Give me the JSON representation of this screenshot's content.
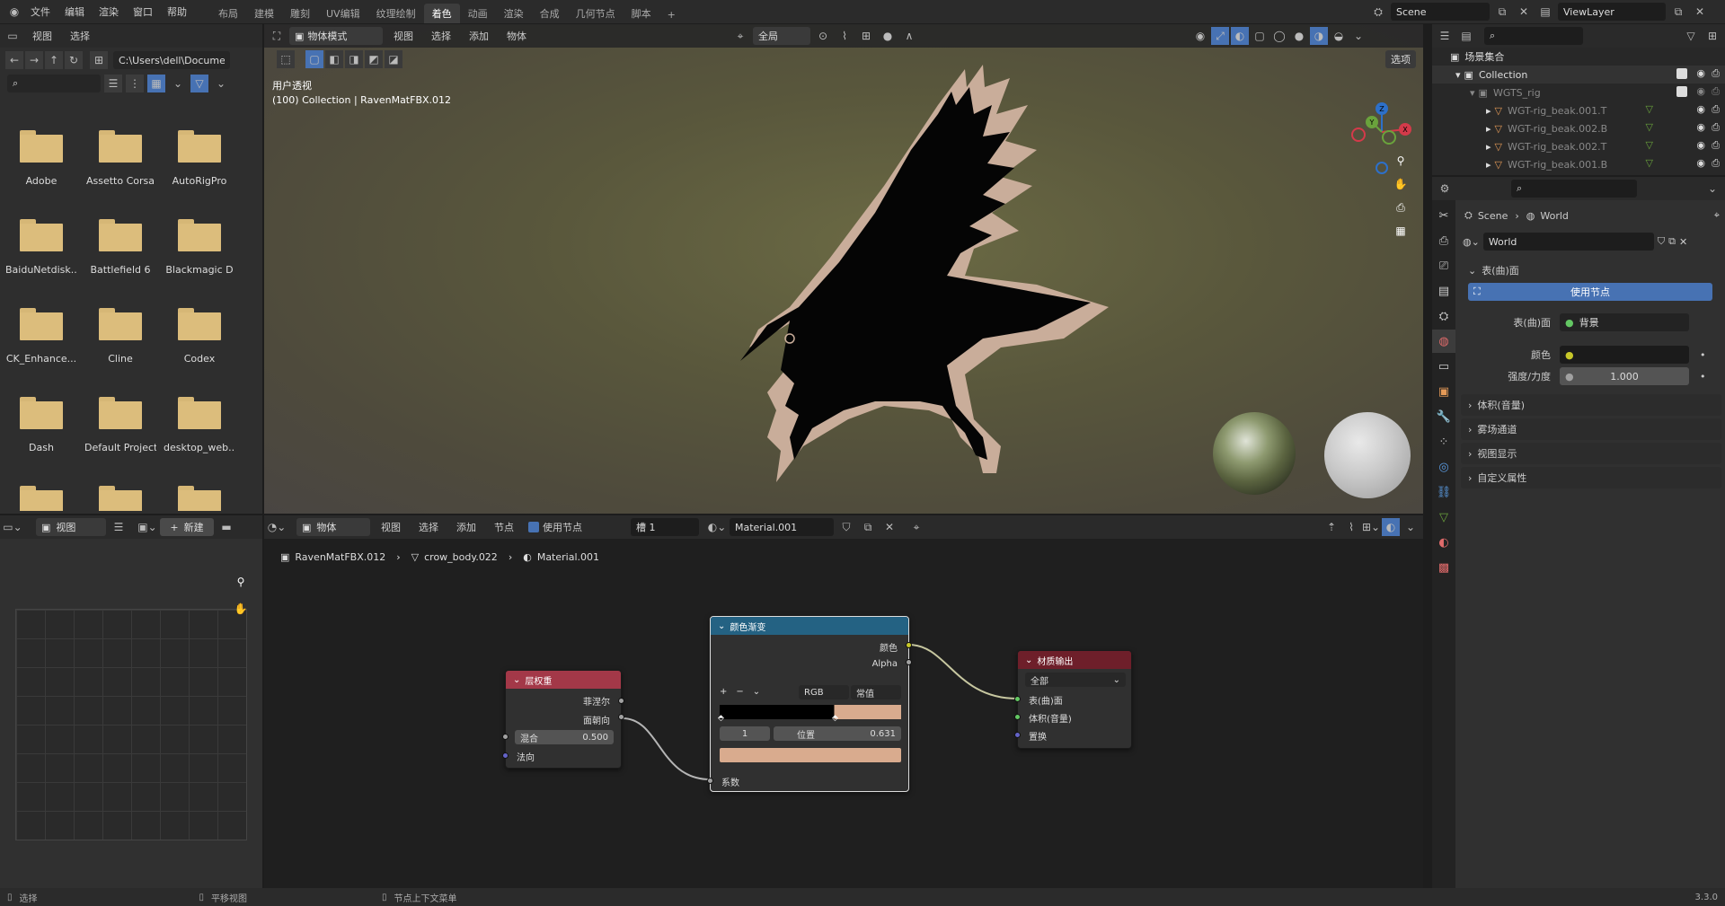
{
  "topbar": {
    "menus": [
      "文件",
      "编辑",
      "渲染",
      "窗口",
      "帮助"
    ],
    "workspaces": [
      "布局",
      "建模",
      "雕刻",
      "UV编辑",
      "纹理绘制",
      "着色",
      "动画",
      "渲染",
      "合成",
      "几何节点",
      "脚本"
    ],
    "active_workspace": "着色",
    "scene": "Scene",
    "view_layer": "ViewLayer"
  },
  "file_browser": {
    "menus": [
      "视图",
      "选择"
    ],
    "path": "C:\\Users\\dell\\Docume...",
    "folders": [
      "Adobe",
      "Assetto Corsa",
      "AutoRigPro",
      "BaiduNetdisk...",
      "Battlefield 6",
      "Blackmagic D",
      "CK_Enhance...",
      "Cline",
      "Codex",
      "Dash",
      "Default Project",
      "desktop_web..."
    ]
  },
  "viewport": {
    "mode": "物体模式",
    "menus": [
      "视图",
      "选择",
      "添加",
      "物体"
    ],
    "transform": "全局",
    "options": "选项",
    "view_name": "用户透视",
    "object_info": "(100) Collection | RavenMatFBX.012",
    "gizmo": {
      "x": "X",
      "y": "Y",
      "z": "Z"
    }
  },
  "outliner": {
    "root": "场景集合",
    "items": [
      {
        "label": "Collection",
        "level": 1
      },
      {
        "label": "WGTS_rig",
        "level": 2
      },
      {
        "label": "WGT-rig_beak.001.T",
        "level": 3
      },
      {
        "label": "WGT-rig_beak.002.B",
        "level": 3
      },
      {
        "label": "WGT-rig_beak.002.T",
        "level": 3
      },
      {
        "label": "WGT-rig_beak.001.B",
        "level": 3
      }
    ]
  },
  "properties": {
    "breadcrumb": [
      "Scene",
      "World"
    ],
    "world_name": "World",
    "surface_section": "表(曲)面",
    "use_nodes_button": "使用节点",
    "surface_label": "表(曲)面",
    "surface_value": "背景",
    "color_label": "颜色",
    "strength_label": "强度/力度",
    "strength_value": "1.000",
    "collapsed_sections": [
      "体积(音量)",
      "雾场通道",
      "视图显示",
      "自定义属性"
    ]
  },
  "image_editor": {
    "view_menu": "视图",
    "new_button": "新建"
  },
  "node_editor": {
    "type": "物体",
    "menus": [
      "视图",
      "选择",
      "添加",
      "节点"
    ],
    "use_nodes_label": "使用节点",
    "slot": "槽 1",
    "material": "Material.001",
    "breadcrumb": [
      "RavenMatFBX.012",
      "crow_body.022",
      "Material.001"
    ],
    "nodes": {
      "layer_weight": {
        "title": "层权重",
        "out_fresnel": "菲涅尔",
        "out_facing": "面朝向",
        "blend_label": "混合",
        "blend_value": "0.500",
        "in_normal": "法向"
      },
      "color_ramp": {
        "title": "颜色渐变",
        "out_color": "颜色",
        "out_alpha": "Alpha",
        "mode": "RGB",
        "interp": "常值",
        "index": "1",
        "pos_label": "位置",
        "pos_value": "0.631",
        "in_fac": "系数"
      },
      "material_output": {
        "title": "材质输出",
        "target": "全部",
        "in_surface": "表(曲)面",
        "in_volume": "体积(音量)",
        "in_displace": "置换"
      }
    },
    "colors": {
      "ramp_light": "#d9ab8e",
      "header_red": "#a33848",
      "header_blue": "#246283",
      "header_out": "#6e1f2a"
    }
  },
  "statusbar": {
    "select": "选择",
    "pan": "平移视图",
    "context": "节点上下文菜单",
    "version": "3.3.0"
  }
}
